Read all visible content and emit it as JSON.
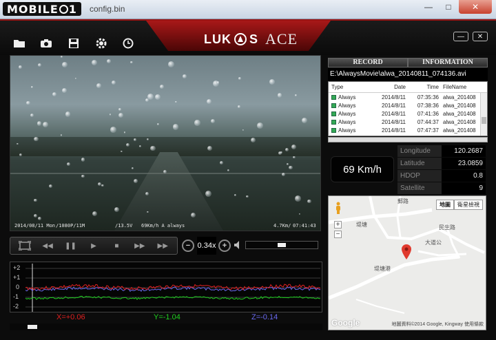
{
  "window": {
    "logo": "MOBILE01",
    "filename": "config.bin",
    "min": "—",
    "max": "□",
    "close": "✕"
  },
  "header": {
    "brand_left": "LUK",
    "brand_right": "S",
    "brand_ace": "ACE",
    "btn_min": "—",
    "btn_close": "✕"
  },
  "video": {
    "osd_date": "2014/08/11 Mon",
    "osd_res": "/1080P/11M",
    "osd_volt": "/13.5V",
    "osd_speed": "69Km/h A always",
    "osd_bitrate": "4.7Km/",
    "osd_time": "07:41:43"
  },
  "player": {
    "zoom_value": "0.34x",
    "volume_level": 0.5
  },
  "gsensor": {
    "y_labels": [
      "+2",
      "+1",
      "0",
      "-1",
      "-2"
    ],
    "x_readout": "X=+0.06",
    "y_readout": "Y=-1.04",
    "z_readout": "Z=-0.14",
    "x_color": "#e02020",
    "y_color": "#20d020",
    "z_color": "#6a6af0"
  },
  "tabs": {
    "record": "RECORD",
    "information": "INFORMATION"
  },
  "path": "E:\\AlwaysMovie\\alwa_20140811_074136.avi",
  "filelist": {
    "headers": [
      "Type",
      "Date",
      "Time",
      "FileName"
    ],
    "rows": [
      [
        "Always",
        "2014/8/11",
        "07:35:36",
        "alwa_201408"
      ],
      [
        "Always",
        "2014/8/11",
        "07:38:36",
        "alwa_201408"
      ],
      [
        "Always",
        "2014/8/11",
        "07:41:36",
        "alwa_201408"
      ],
      [
        "Always",
        "2014/8/11",
        "07:44:37",
        "alwa_201408"
      ],
      [
        "Always",
        "2014/8/11",
        "07:47:37",
        "alwa_201408"
      ]
    ]
  },
  "speed": "69 Km/h",
  "stats": [
    {
      "label": "Longitude",
      "value": "120.2687"
    },
    {
      "label": "Latitude",
      "value": "23.0859"
    },
    {
      "label": "HDOP",
      "value": "0.8"
    },
    {
      "label": "Satellite",
      "value": "9"
    }
  ],
  "map": {
    "btn_map": "地圖",
    "btn_satellite": "衛星檢視",
    "zoom_in": "+",
    "zoom_out": "−",
    "label_1": "民生路",
    "label_2": "大道公",
    "label_3": "堤塘港",
    "label_4": "堤塘",
    "label_5": "郵路",
    "google": "Google",
    "copyright": "地圖資料©2014 Google, Kingway  使用條款"
  }
}
